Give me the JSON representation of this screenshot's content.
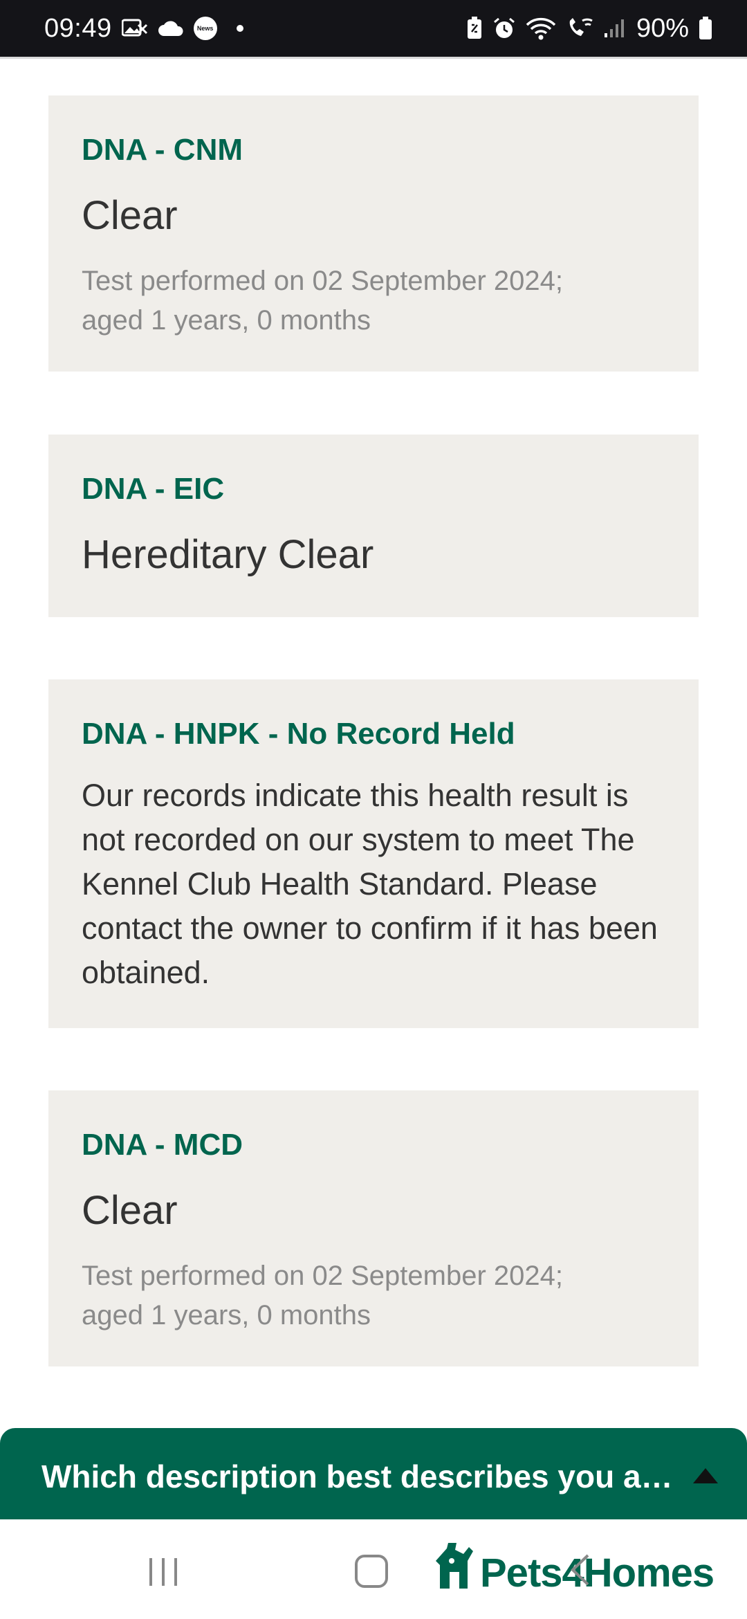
{
  "status_bar": {
    "time": "09:49",
    "news_badge": "News",
    "battery": "90%"
  },
  "cards": [
    {
      "title": "DNA - CNM",
      "result": "Clear",
      "meta_line1": "Test performed on 02 September 2024;",
      "meta_line2": "aged 1 years, 0 months"
    },
    {
      "title": "DNA - EIC",
      "result": "Hereditary Clear"
    },
    {
      "title": "DNA - HNPK - No Record Held",
      "body": "Our records indicate this health result is not recorded on our system to meet The Kennel Club Health Standard. Please contact the owner to confirm if it has been obtained."
    },
    {
      "title": "DNA - MCD",
      "result": "Clear",
      "meta_line1": "Test performed on 02 September 2024;",
      "meta_line2": "aged 1 years, 0 months"
    }
  ],
  "survey": {
    "prompt": "Which description best describes you a…"
  },
  "footer": {
    "logo_text": "Pets4Homes"
  },
  "colors": {
    "brand_green": "#00654e",
    "card_bg": "#f0eeea",
    "status_bar_bg": "#141418"
  },
  "icons": [
    "image-notification-icon",
    "cloud-icon",
    "news-icon",
    "battery-saver-icon",
    "alarm-icon",
    "wifi-icon",
    "wifi-calling-icon",
    "signal-icon",
    "battery-icon",
    "caret-up-icon",
    "recents-icon",
    "home-icon",
    "back-icon",
    "pets4homes-logo-icon"
  ]
}
